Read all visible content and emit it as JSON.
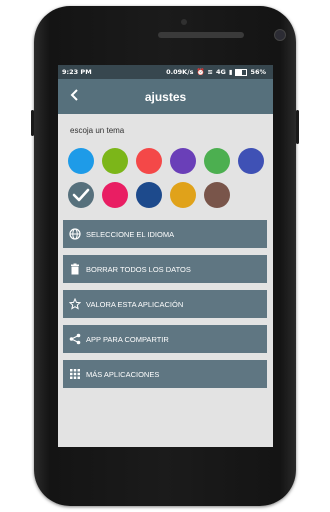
{
  "status_bar": {
    "time": "9:23 PM",
    "speed": "0.09K/s",
    "network": "4G",
    "battery": "56%"
  },
  "app_bar": {
    "title": "ajustes",
    "back_icon": "chevron-left-icon"
  },
  "theme": {
    "label": "escoja un tema",
    "swatches": [
      {
        "color": "#1e9be8"
      },
      {
        "color": "#7cb619"
      },
      {
        "color": "#f44848"
      },
      {
        "color": "#6a3fb8"
      },
      {
        "color": "#4caf50"
      },
      {
        "color": "#3f51b5"
      },
      {
        "color": "#56707c",
        "selected": true
      },
      {
        "color": "#e91e63"
      },
      {
        "color": "#1d4a8c"
      },
      {
        "color": "#e0a21a"
      },
      {
        "color": "#79554a"
      }
    ]
  },
  "menu": [
    {
      "label": "SELECCIONE EL IDIOMA",
      "icon": "globe-icon"
    },
    {
      "label": "BORRAR TODOS LOS DATOS",
      "icon": "trash-icon"
    },
    {
      "label": "VALORA ESTA APLICACIÓN",
      "icon": "star-icon"
    },
    {
      "label": "APP PARA COMPARTIR",
      "icon": "share-icon"
    },
    {
      "label": "MÁS APLICACIONES",
      "icon": "grid-icon"
    }
  ]
}
